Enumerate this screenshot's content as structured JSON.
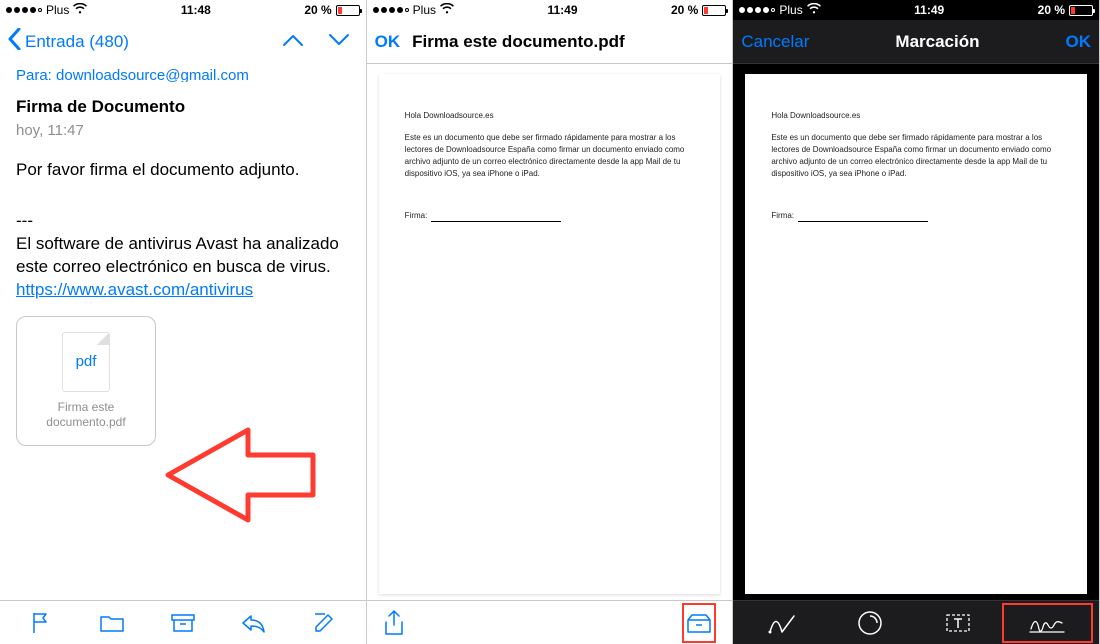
{
  "panel1": {
    "status": {
      "carrier": "Plus",
      "time": "11:48",
      "battery": "20 %"
    },
    "nav": {
      "back": "Entrada (480)"
    },
    "from_line": "Para: downloadsource@gmail.com",
    "subject": "Firma de Documento",
    "date": "hoy, 11:47",
    "body": "Por favor firma el documento adjunto.",
    "divider": "---",
    "footer": "El software de antivirus Avast ha analizado este correo electrónico en busca de virus.",
    "link": "https://www.avast.com/antivirus",
    "attachment": {
      "ext": "pdf",
      "name": "Firma este documento.pdf"
    }
  },
  "panel2": {
    "status": {
      "carrier": "Plus",
      "time": "11:49",
      "battery": "20 %"
    },
    "nav": {
      "ok": "OK",
      "title": "Firma este documento.pdf"
    }
  },
  "panel3": {
    "status": {
      "carrier": "Plus",
      "time": "11:49",
      "battery": "20 %"
    },
    "nav": {
      "cancel": "Cancelar",
      "title": "Marcación",
      "ok": "OK"
    }
  },
  "doc": {
    "greet": "Hola Downloadsource.es",
    "para": "Este es un documento que debe ser firmado rápidamente para mostrar a los lectores de Downloadsource España como firmar un documento enviado como archivo adjunto de un correo electrónico directamente desde la app Mail de tu dispositivo iOS, ya sea iPhone o iPad.",
    "sig_label": "Firma:"
  }
}
